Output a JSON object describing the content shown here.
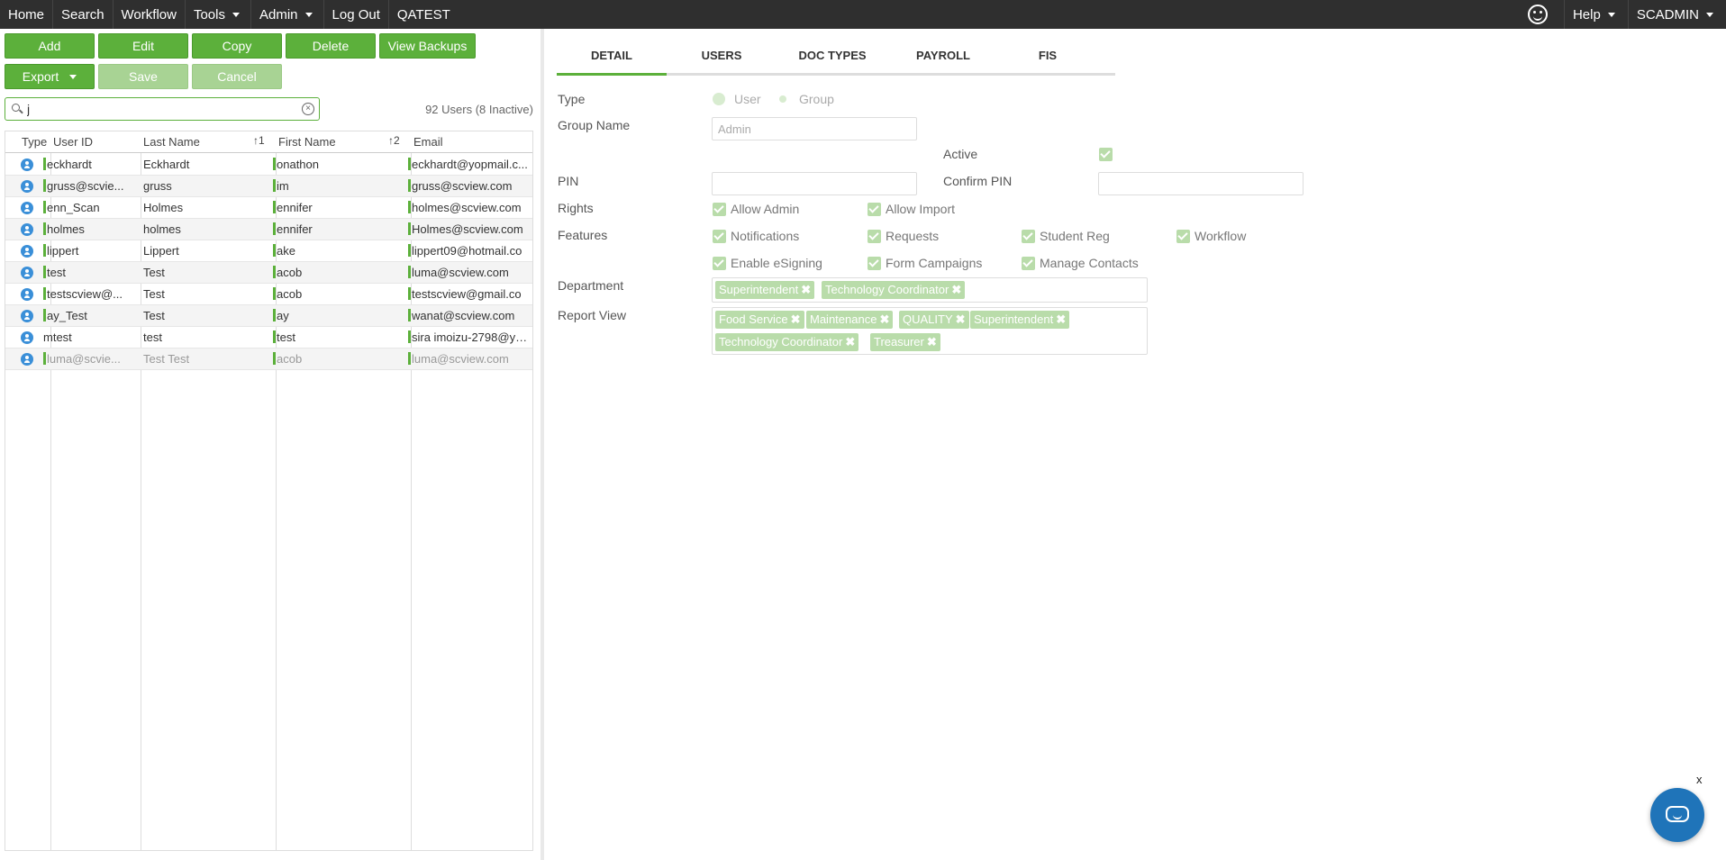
{
  "nav": {
    "home": "Home",
    "search": "Search",
    "workflow": "Workflow",
    "tools": "Tools",
    "admin": "Admin",
    "logout": "Log Out",
    "env": "QATEST",
    "help": "Help",
    "user": "SCADMIN"
  },
  "toolbar": {
    "add": "Add",
    "edit": "Edit",
    "copy": "Copy",
    "delete": "Delete",
    "view_backups": "View Backups",
    "export": "Export",
    "save": "Save",
    "cancel": "Cancel"
  },
  "search": {
    "value": "j",
    "placeholder": ""
  },
  "summary": "92 Users (8 Inactive)",
  "grid": {
    "headers": [
      "Type",
      "User ID",
      "Last Name",
      "First Name",
      "Email"
    ],
    "sort_last": "1",
    "sort_first": "2",
    "rows": [
      {
        "user_id_hl": true,
        "user_id": "eckhardt",
        "last": "Eckhardt",
        "first": "onathon",
        "email": "eckhardt@yopmail.c...",
        "inactive": false
      },
      {
        "user_id_hl": true,
        "user_id": "gruss@scvie...",
        "last": "gruss",
        "first": "im",
        "email": "gruss@scview.com",
        "inactive": false
      },
      {
        "user_id_hl": true,
        "user_id": "enn_Scan",
        "last": "Holmes",
        "first": "ennifer",
        "email": "holmes@scview.com",
        "inactive": false
      },
      {
        "user_id_hl": true,
        "user_id": "holmes",
        "last": "holmes",
        "first": "ennifer",
        "email": "Holmes@scview.com",
        "inactive": false
      },
      {
        "user_id_hl": true,
        "user_id": "lippert",
        "last": "Lippert",
        "first": "ake",
        "email": "lippert09@hotmail.co",
        "inactive": false
      },
      {
        "user_id_hl": true,
        "user_id": "test",
        "last": "Test",
        "first": "acob",
        "email": "luma@scview.com",
        "inactive": false
      },
      {
        "user_id_hl": true,
        "user_id": "testscview@...",
        "last": "Test",
        "first": "acob",
        "email": "testscview@gmail.co",
        "inactive": false
      },
      {
        "user_id_hl": true,
        "user_id": "ay_Test",
        "last": "Test",
        "first": "ay",
        "email": "wanat@scview.com",
        "inactive": false
      },
      {
        "user_id_hl": false,
        "user_id": "mtest",
        "last": "test",
        "first": "test",
        "email": "sira imoizu-2798@yo...",
        "inactive": false
      },
      {
        "user_id_hl": true,
        "user_id": "luma@scvie...",
        "last": "Test Test",
        "first": "acob",
        "email": "luma@scview.com",
        "inactive": true
      }
    ]
  },
  "tabs": [
    "DETAIL",
    "USERS",
    "DOC TYPES",
    "PAYROLL",
    "FIS"
  ],
  "detail": {
    "type_label": "Type",
    "type_user": "User",
    "type_group": "Group",
    "group_name_label": "Group Name",
    "group_name_value": "Admin",
    "active_label": "Active",
    "pin_label": "PIN",
    "confirm_pin_label": "Confirm PIN",
    "rights_label": "Rights",
    "rights": [
      "Allow Admin",
      "Allow Import"
    ],
    "features_label": "Features",
    "features": [
      "Notifications",
      "Requests",
      "Student Reg",
      "Workflow",
      "Enable eSigning",
      "Form Campaigns",
      "Manage Contacts"
    ],
    "department_label": "Department",
    "departments": [
      "Superintendent",
      "Technology Coordinator"
    ],
    "report_view_label": "Report View",
    "report_views": [
      "Food Service",
      "Maintenance",
      "QUALITY",
      "Superintendent",
      "Technology Coordinator",
      "Treasurer"
    ]
  },
  "chat": {
    "close": "x"
  },
  "colors": {
    "accent": "#5cb03b",
    "nav": "#2f2f2f",
    "chat": "#1f74b9"
  }
}
